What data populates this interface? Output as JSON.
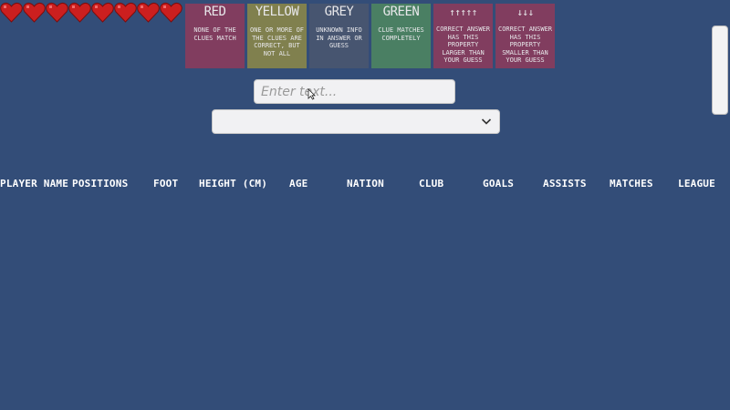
{
  "lives": {
    "count": 8,
    "icon": "heart-icon",
    "color": "#cc1f1f"
  },
  "legend": [
    {
      "key": "red",
      "title": "RED",
      "description": "NONE OF THE CLUES MATCH",
      "color": "#813d5f"
    },
    {
      "key": "yellow",
      "title": "YELLOW",
      "description": "ONE OR MORE OF THE CLUES ARE CORRECT, BUT NOT ALL",
      "color": "#80804e"
    },
    {
      "key": "grey",
      "title": "GREY",
      "description": "UNKNOWN INFO IN ANSWER OR GUESS",
      "color": "#475570"
    },
    {
      "key": "green",
      "title": "GREEN",
      "description": "CLUE MATCHES COMPLETELY",
      "color": "#4a7f63"
    },
    {
      "key": "up",
      "title": "↑↑↑↑↑",
      "description": "CORRECT ANSWER HAS THIS PROPERTY LARGER THAN YOUR GUESS",
      "color": "#813d5f"
    },
    {
      "key": "down",
      "title": "↓↓↓",
      "description": "CORRECT ANSWER HAS THIS PROPERTY SMALLER THAN YOUR GUESS",
      "color": "#813d5f"
    }
  ],
  "search": {
    "placeholder": "Enter text...",
    "value": ""
  },
  "dropdown": {
    "value": ""
  },
  "table": {
    "columns": [
      "Player Name",
      "Positions",
      "Foot",
      "Height (cm)",
      "Age",
      "Nation",
      "Club",
      "Goals",
      "Assists",
      "Matches",
      "League"
    ]
  },
  "colors": {
    "background": "#334d78"
  }
}
